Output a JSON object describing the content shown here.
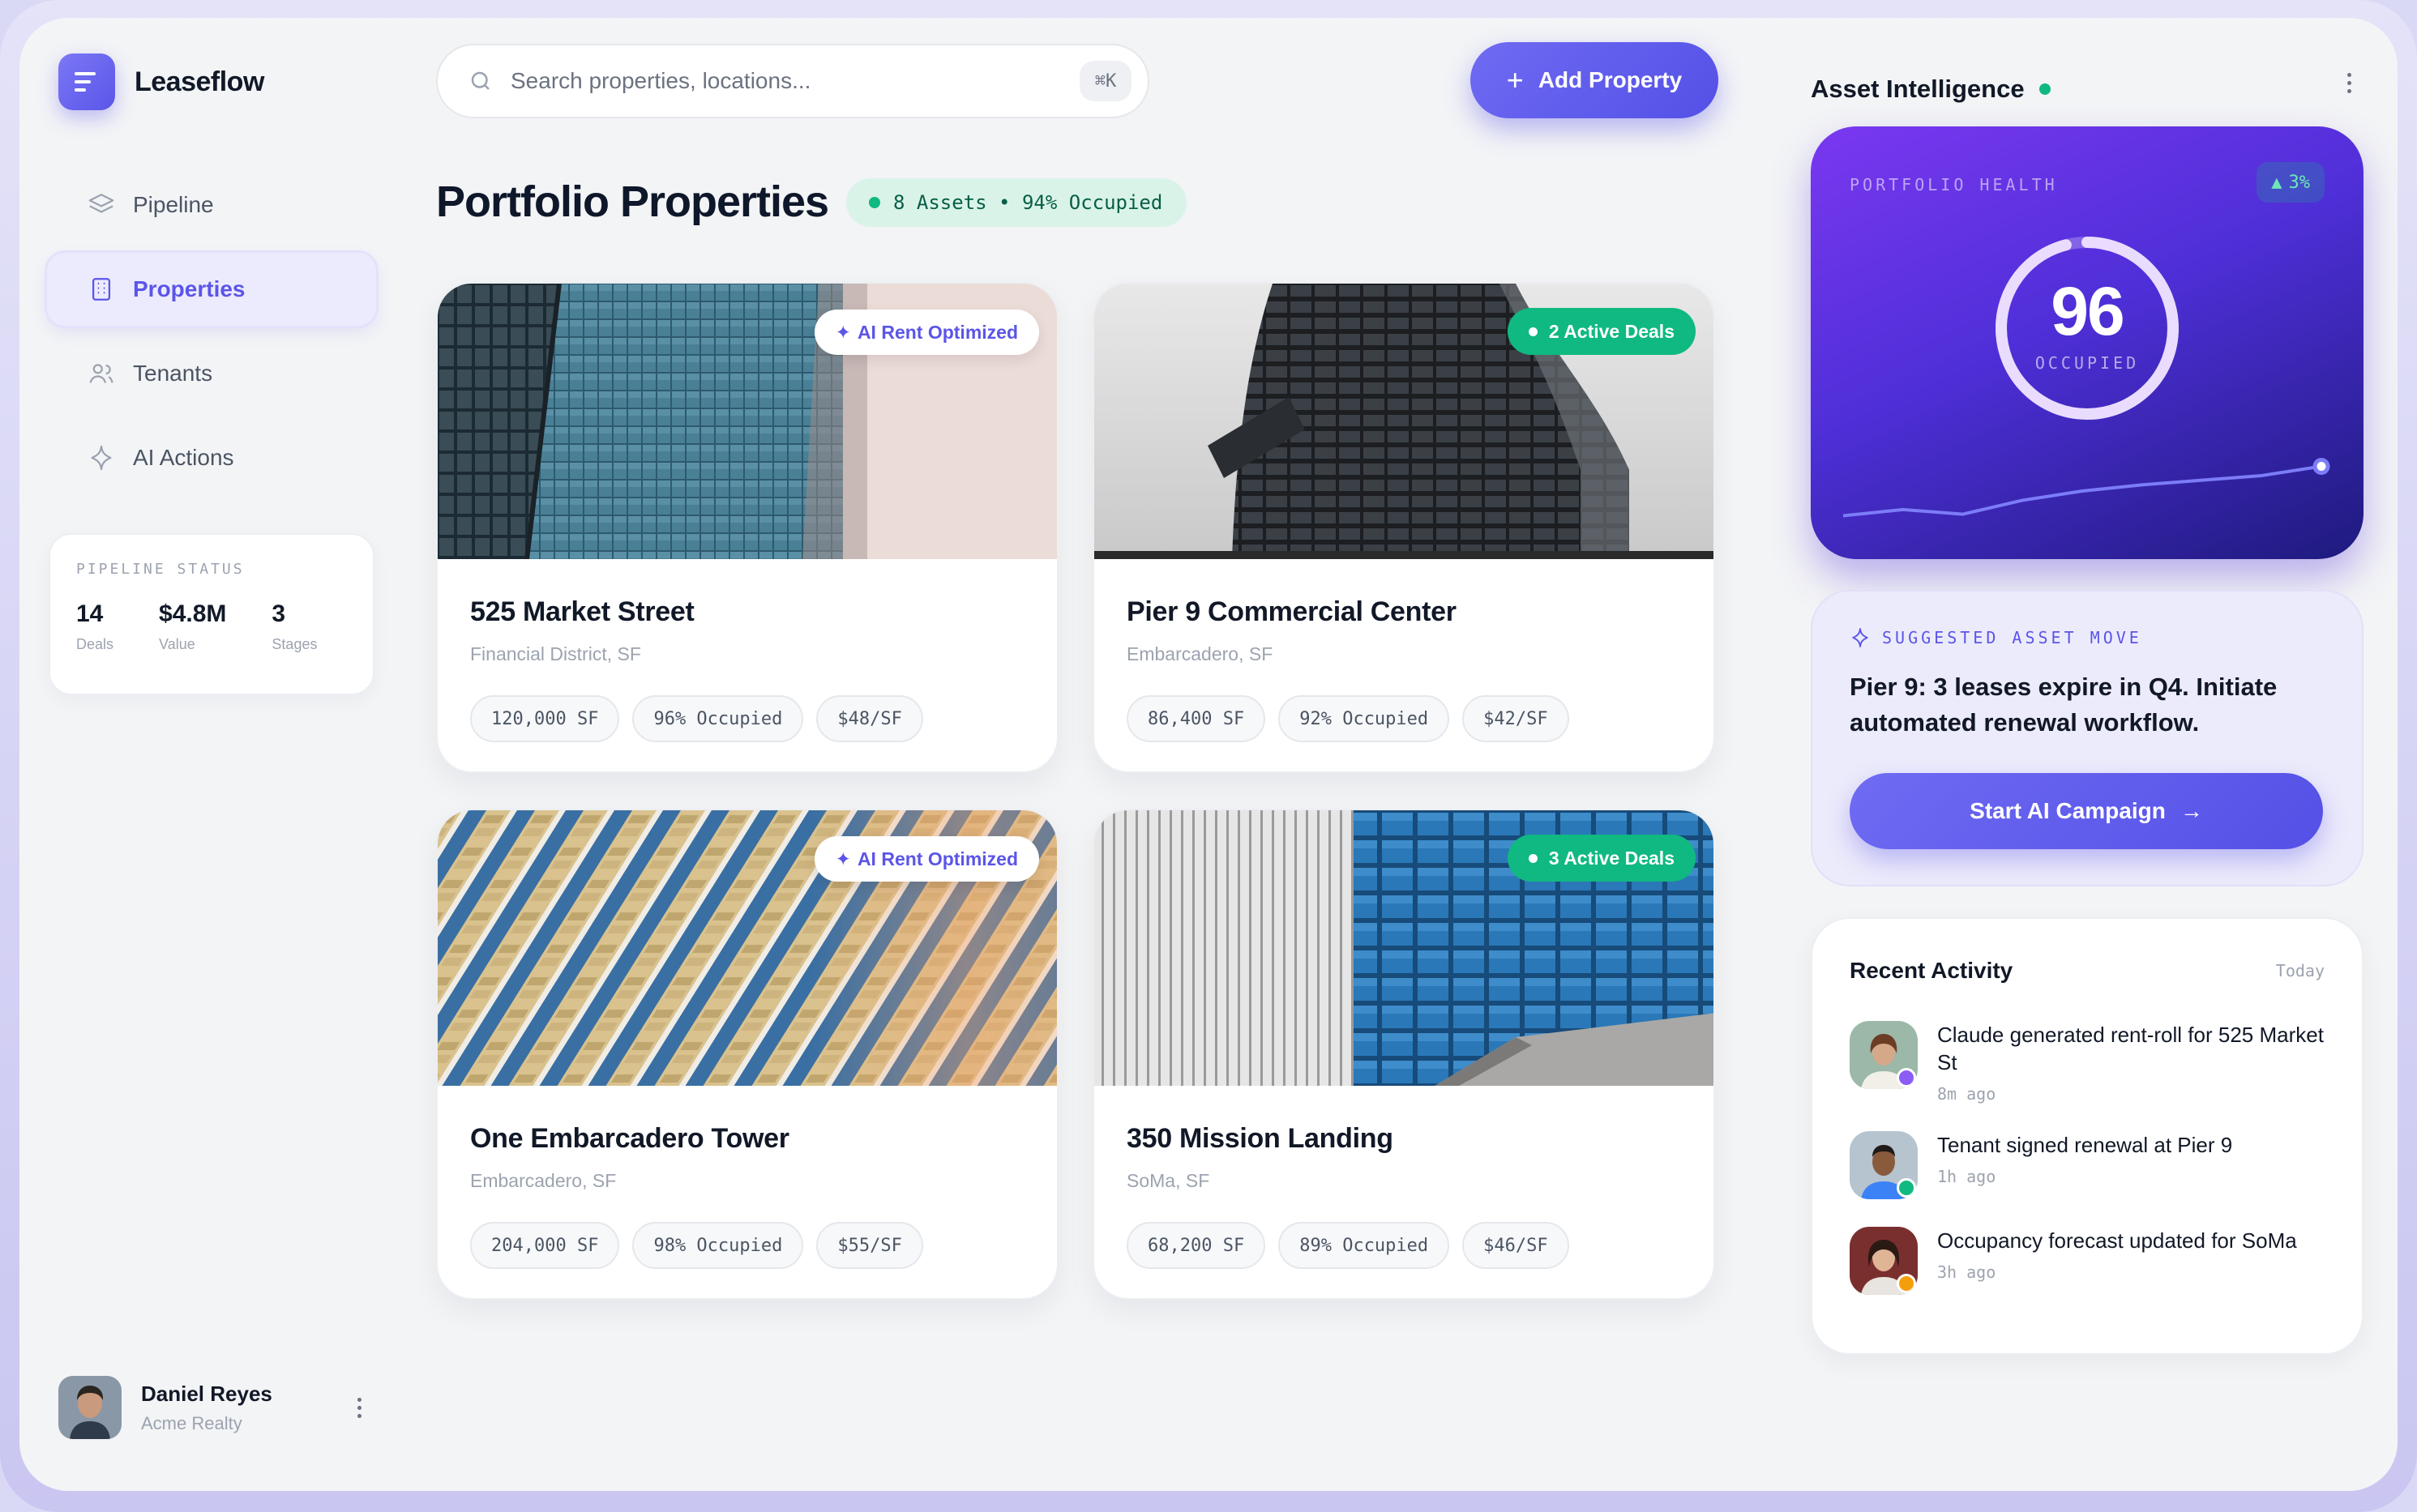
{
  "brand": {
    "name": "Leaseflow",
    "accent": "#5b55e8"
  },
  "sidebar": {
    "items": [
      {
        "label": "Pipeline",
        "icon": "layers-icon"
      },
      {
        "label": "Properties",
        "icon": "building-icon",
        "active": true
      },
      {
        "label": "Tenants",
        "icon": "users-icon"
      },
      {
        "label": "AI Actions",
        "icon": "sparkle-icon"
      }
    ],
    "pipeline_status": {
      "label": "PIPELINE STATUS",
      "stats": [
        {
          "value": "14",
          "label": "Deals"
        },
        {
          "value": "$4.8M",
          "label": "Value"
        },
        {
          "value": "3",
          "label": "Stages"
        }
      ]
    },
    "user": {
      "name": "Daniel Reyes",
      "org": "Acme Realty"
    }
  },
  "search": {
    "placeholder": "Search properties, locations...",
    "shortcut": "⌘K"
  },
  "toolbar": {
    "add_label": "Add Property"
  },
  "main": {
    "title": "Portfolio Properties",
    "summary": "8 Assets • 94% Occupied",
    "properties": [
      {
        "name": "525 Market Street",
        "location": "Financial District, SF",
        "badge": "AI Rent Optimized",
        "badge_type": "ai",
        "tags": [
          "120,000 SF",
          "96% Occupied",
          "$48/SF"
        ]
      },
      {
        "name": "Pier 9 Commercial Center",
        "location": "Embarcadero, SF",
        "badge": "2 Active Deals",
        "badge_type": "deals",
        "tags": [
          "86,400 SF",
          "92% Occupied",
          "$42/SF"
        ]
      },
      {
        "name": "One Embarcadero Tower",
        "location": "Embarcadero, SF",
        "badge": "AI Rent Optimized",
        "badge_type": "ai",
        "tags": [
          "204,000 SF",
          "98% Occupied",
          "$55/SF"
        ]
      },
      {
        "name": "350 Mission Landing",
        "location": "SoMa, SF",
        "badge": "3 Active Deals",
        "badge_type": "deals",
        "tags": [
          "68,200 SF",
          "89% Occupied",
          "$46/SF"
        ]
      }
    ]
  },
  "right": {
    "title": "Asset Intelligence",
    "health": {
      "label": "PORTFOLIO HEALTH",
      "delta": "3%",
      "score": "96",
      "score_label": "OCCUPIED",
      "score_fraction": 0.96,
      "trend": [
        30,
        34,
        31,
        40,
        46,
        50,
        53,
        56,
        62
      ]
    },
    "suggestion": {
      "label": "SUGGESTED ASSET MOVE",
      "message": "Pier 9: 3 leases expire in Q4. Initiate automated renewal workflow.",
      "cta": "Start AI Campaign"
    },
    "activity": {
      "title": "Recent Activity",
      "date": "Today",
      "items": [
        {
          "text": "Claude generated rent-roll for 525 Market St",
          "time": "8m ago",
          "status_color": "#8b5cf6"
        },
        {
          "text": "Tenant signed renewal at Pier 9",
          "time": "1h ago",
          "status_color": "#10b981"
        },
        {
          "text": "Occupancy forecast updated for SoMa",
          "time": "3h ago",
          "status_color": "#f59e0b"
        }
      ]
    }
  }
}
